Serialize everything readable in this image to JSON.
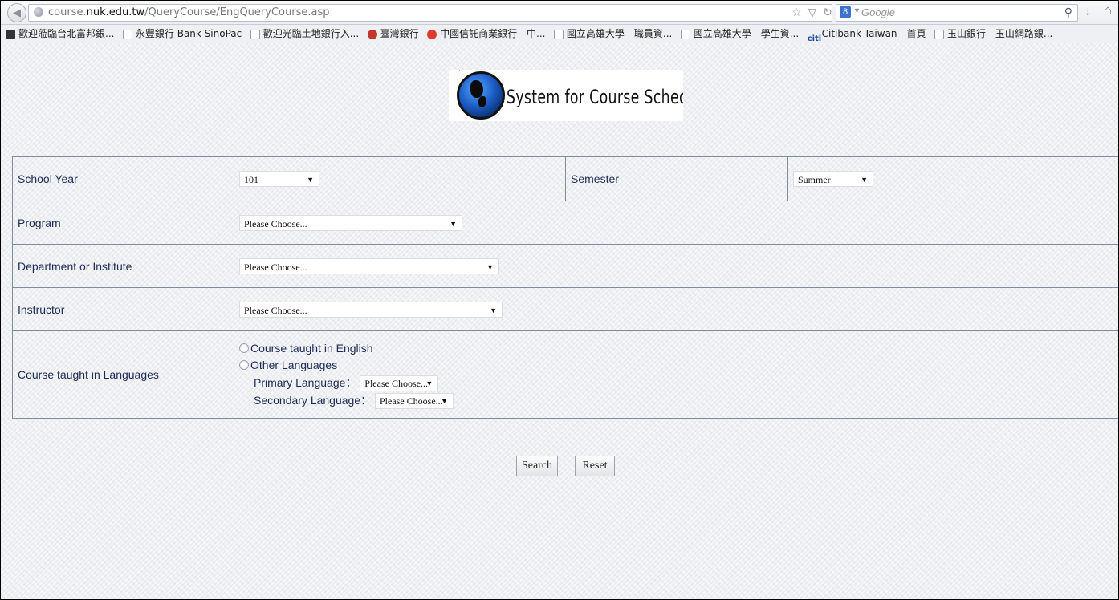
{
  "browser": {
    "url_prefix": "course.",
    "url_domain": "nuk.edu.tw",
    "url_path": "/QueryCourse/EngQueryCourse.asp",
    "search_placeholder": "Google",
    "bookmarks": [
      {
        "icon": "dark",
        "label": "歡迎蒞臨台北富邦銀..."
      },
      {
        "icon": "blank",
        "label": "永豐銀行 Bank SinoPac"
      },
      {
        "icon": "blank",
        "label": "歡迎光臨土地銀行入..."
      },
      {
        "icon": "seal",
        "label": "臺灣銀行"
      },
      {
        "icon": "red",
        "label": "中國信託商業銀行 - 中..."
      },
      {
        "icon": "blank",
        "label": "國立高雄大學 - 職員資..."
      },
      {
        "icon": "blank",
        "label": "國立高雄大學 - 學生資..."
      },
      {
        "icon": "citi",
        "label": "Citibank Taiwan - 首頁"
      },
      {
        "icon": "blank",
        "label": "玉山銀行 - 玉山網路銀..."
      }
    ]
  },
  "banner": {
    "title": "System for Course Schedule"
  },
  "form": {
    "school_year_label": "School Year",
    "school_year_value": "101",
    "semester_label": "Semester",
    "semester_value": "Summer",
    "program_label": "Program",
    "program_value": "Please Choose...",
    "department_label": "Department or Institute",
    "department_value": "Please Choose...",
    "instructor_label": "Instructor",
    "instructor_value": "Please Choose...",
    "languages_label": "Course taught in Languages",
    "option_english": "Course taught in English",
    "option_other": "Other Languages",
    "primary_label": "Primary Language：",
    "primary_value": "Please Choose...",
    "secondary_label": "Secondary Language：",
    "secondary_value": "Please Choose..."
  },
  "actions": {
    "search_label": "Search",
    "reset_label": "Reset"
  }
}
